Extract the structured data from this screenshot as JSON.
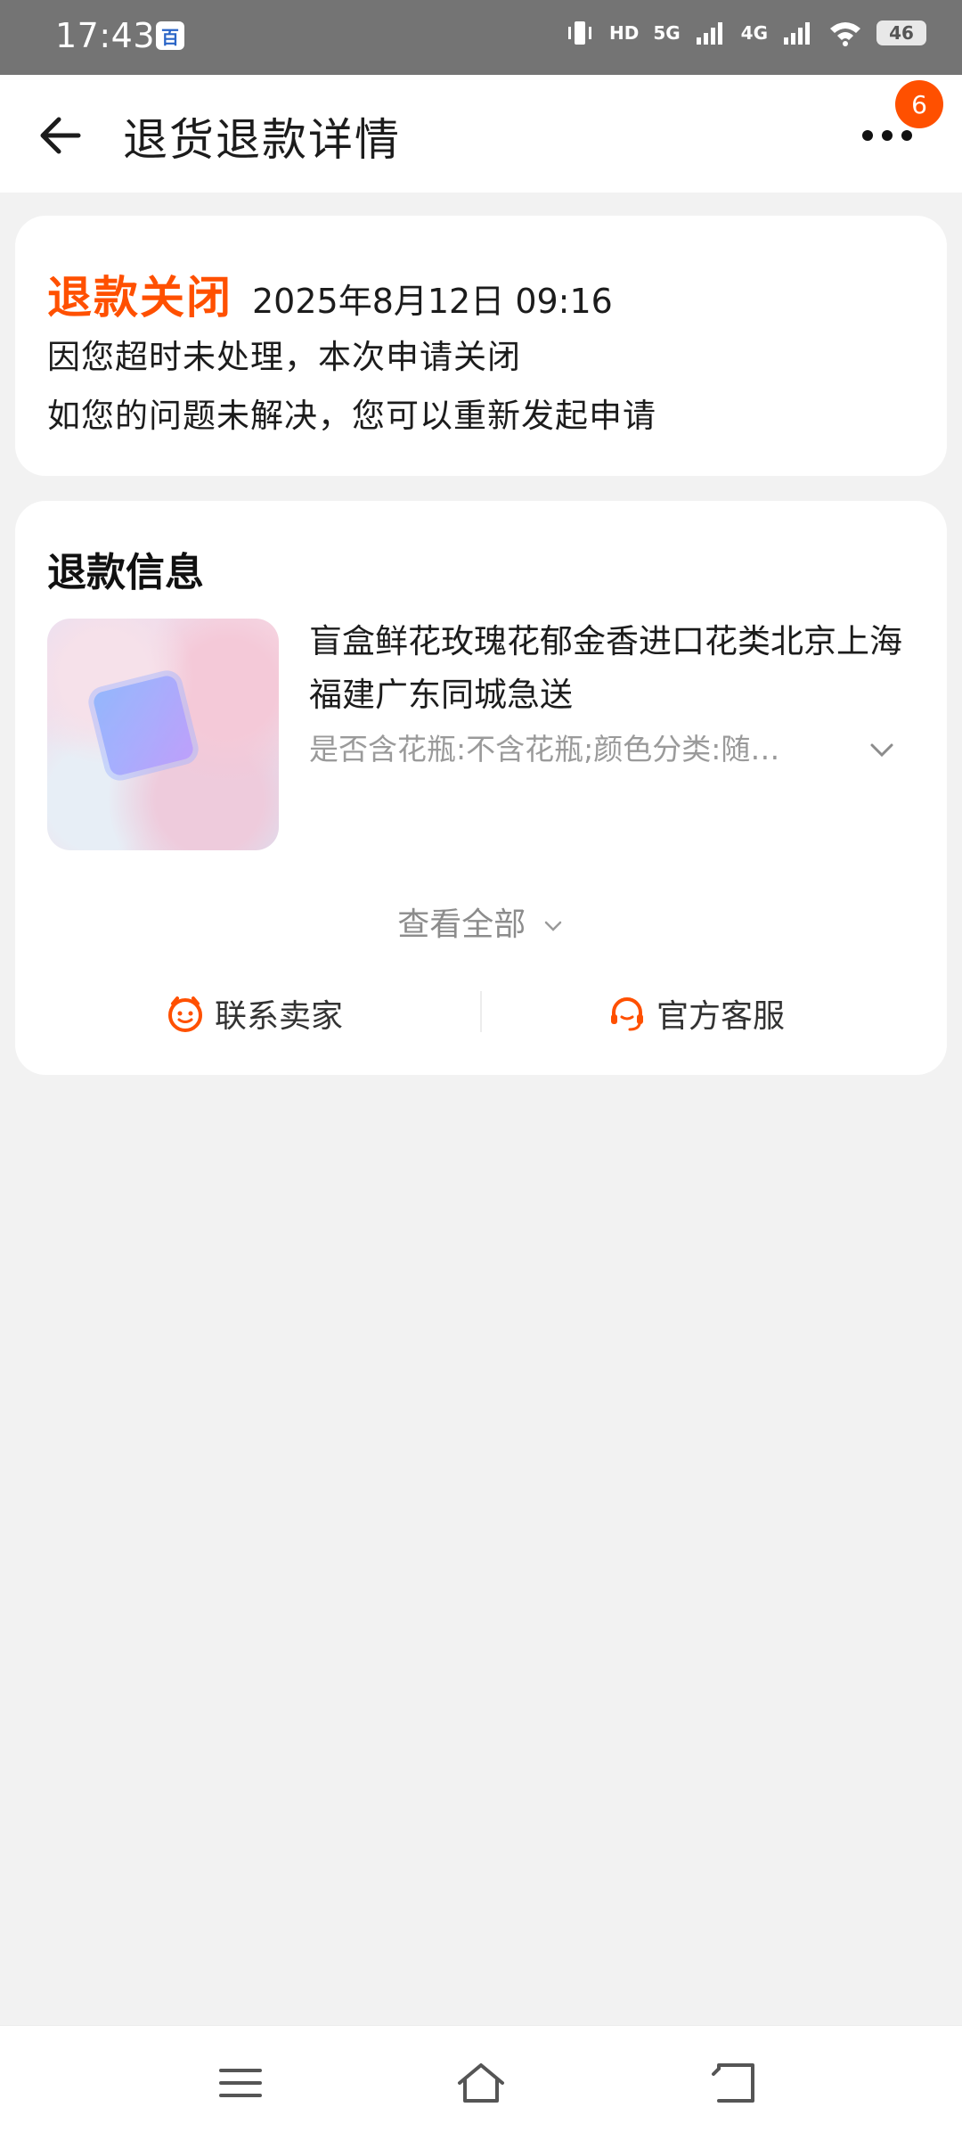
{
  "status_bar": {
    "time": "17:43",
    "app_badge": "百",
    "network_labels": [
      "HD",
      "5G",
      "4G"
    ],
    "battery": "46"
  },
  "header": {
    "title": "退货退款详情",
    "notification_count": "6"
  },
  "refund_status": {
    "title": "退款关闭",
    "datetime": "2025年8月12日 09:16",
    "line1": "因您超时未处理，本次申请关闭",
    "line2": "如您的问题未解决，您可以重新发起申请"
  },
  "refund_info": {
    "section_title": "退款信息",
    "product_name": "盲盒鲜花玫瑰花郁金香进口花类北京上海福建广东同城急送",
    "product_sku": "是否含花瓶:不含花瓶;颜色分类:随…",
    "view_all": "查看全部",
    "contact_seller": "联系卖家",
    "official_service": "官方客服"
  },
  "colors": {
    "accent": "#ff5000",
    "background": "#f2f2f2",
    "card": "#ffffff"
  }
}
